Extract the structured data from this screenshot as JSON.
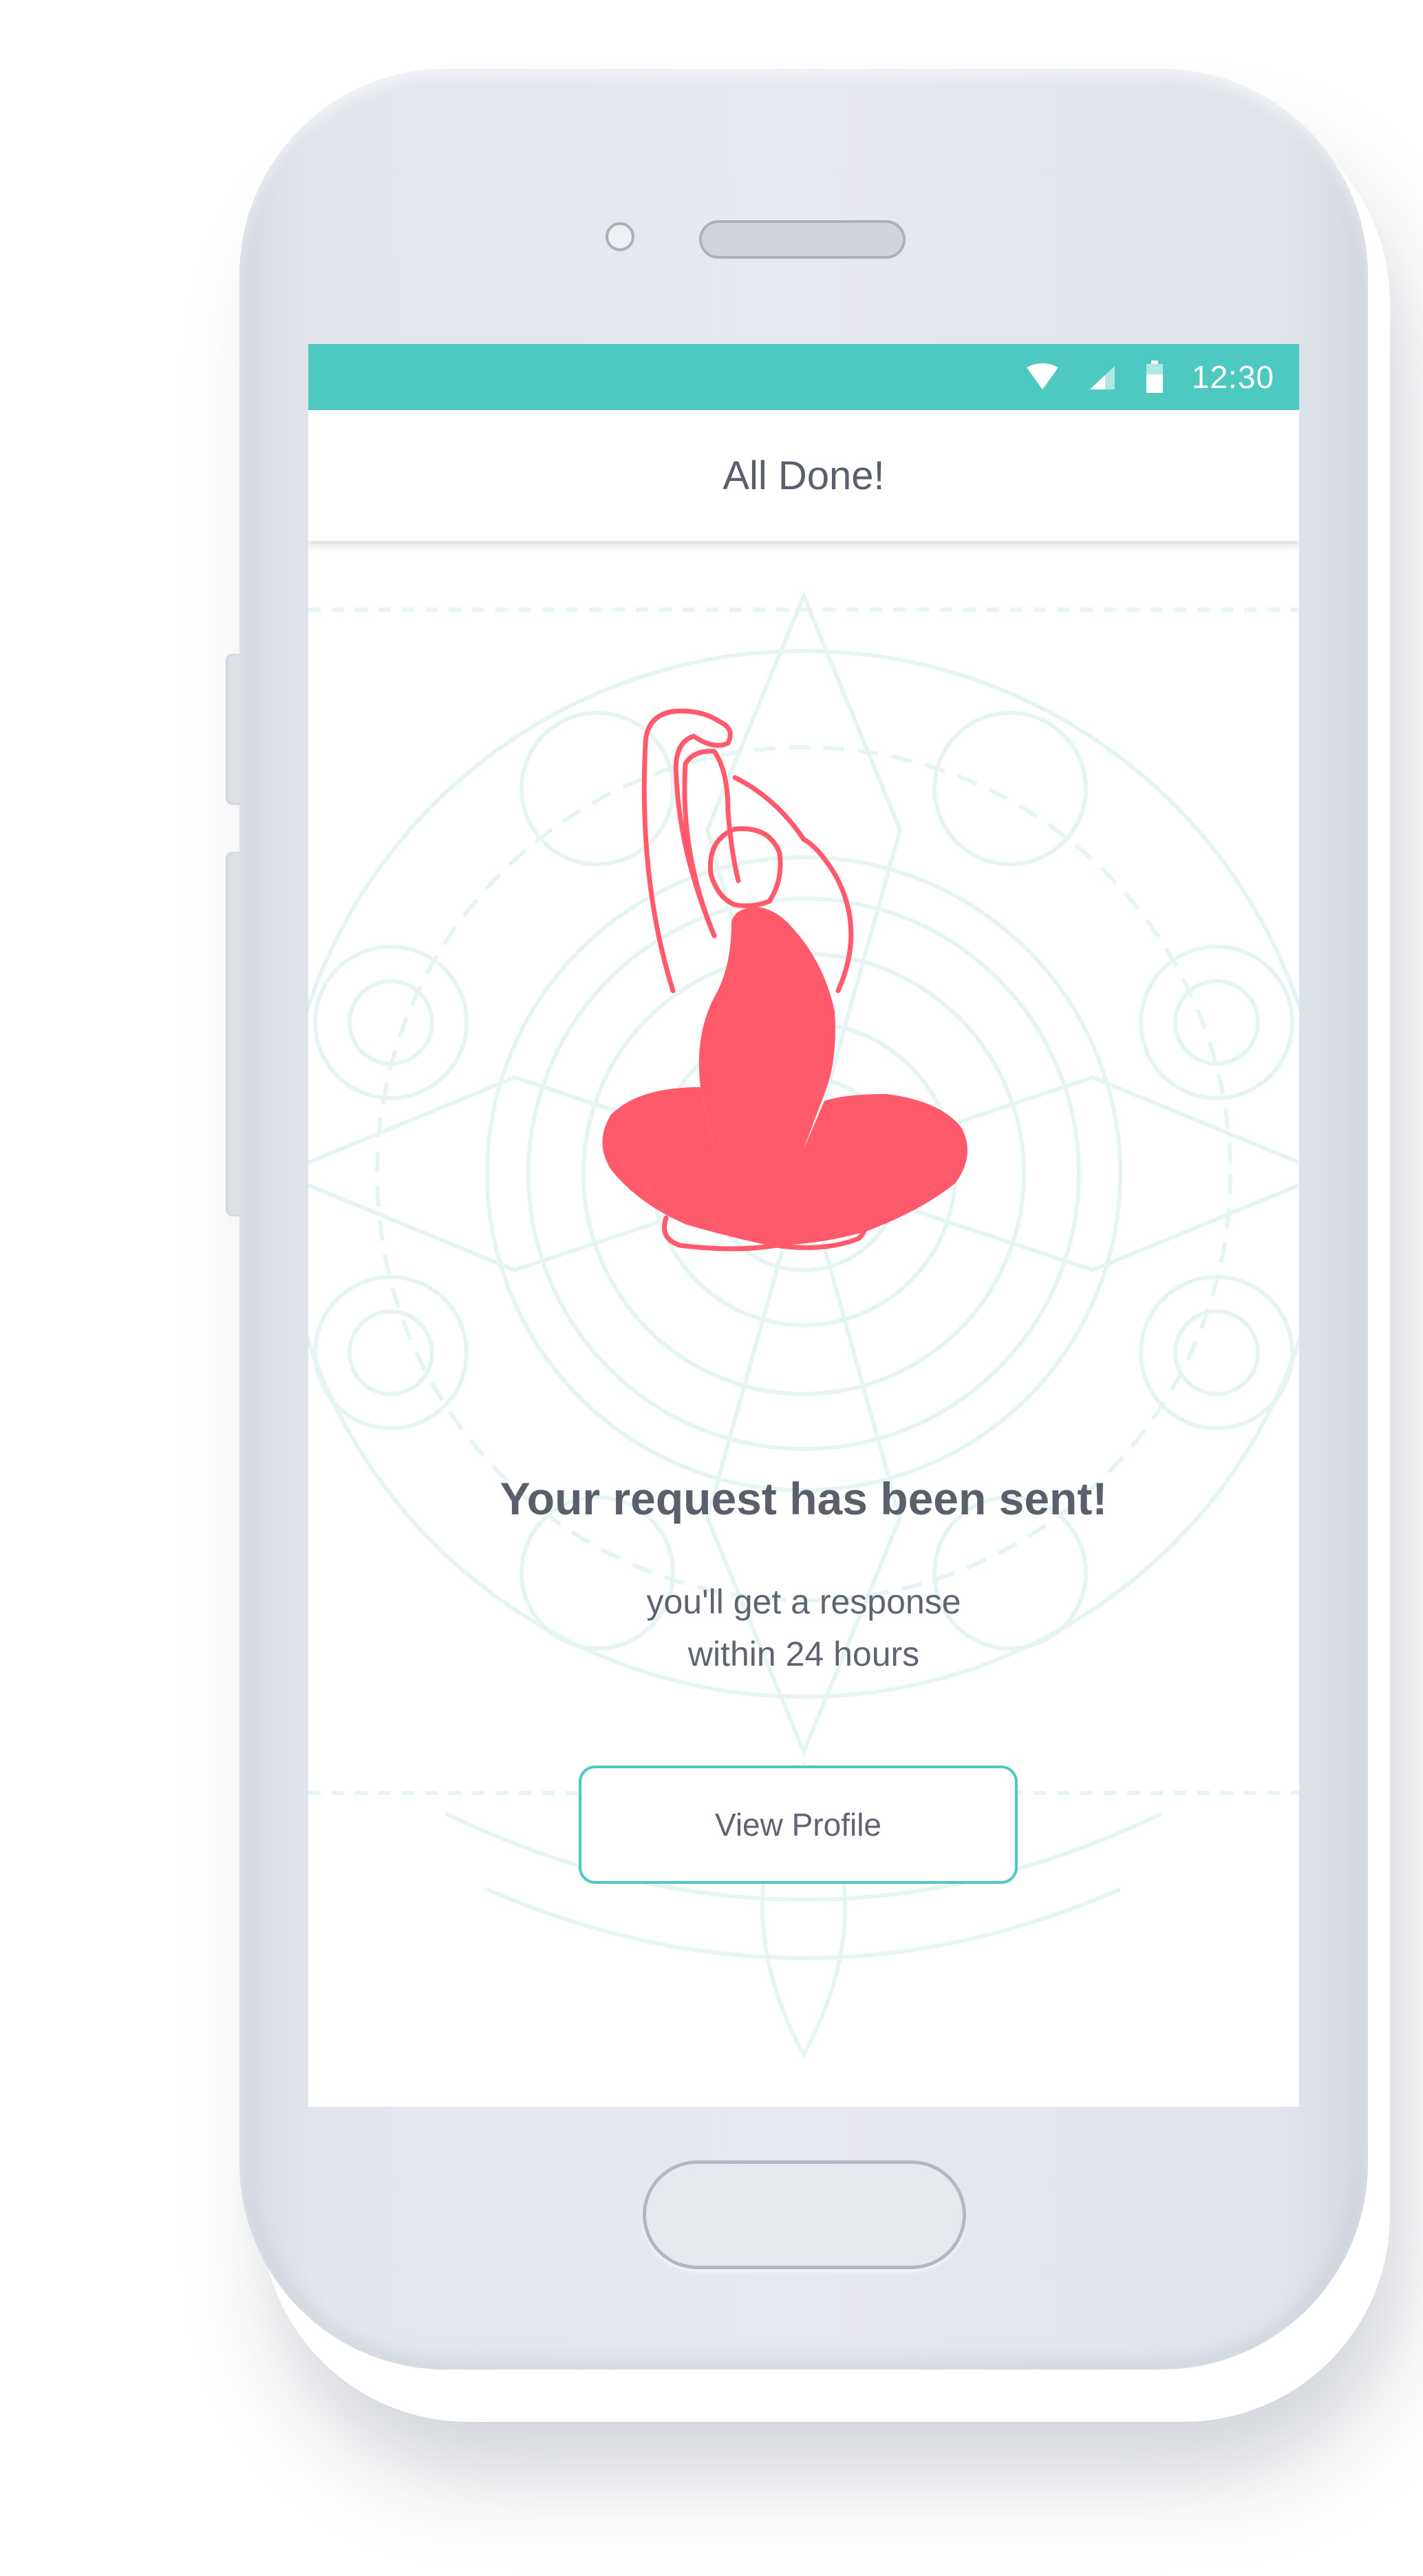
{
  "status_bar": {
    "time": "12:30",
    "icons": [
      "wifi-icon",
      "cell-signal-icon",
      "battery-icon"
    ],
    "color": "#4dc9c2"
  },
  "app_bar": {
    "title": "All Done!"
  },
  "illustration": {
    "icon": "yoga-figure-icon",
    "color": "#ff5a6b"
  },
  "message": {
    "headline": "Your request has been sent!",
    "line1": "you'll get a response",
    "line2": "within 24 hours"
  },
  "actions": {
    "view_profile_label": "View Profile",
    "accent": "#4dc9c2"
  }
}
